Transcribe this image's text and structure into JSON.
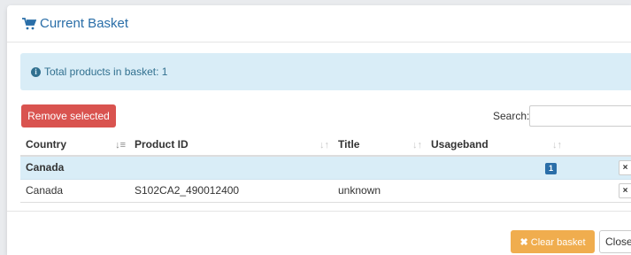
{
  "modal": {
    "title": "Current Basket"
  },
  "alert": {
    "text": "Total products in basket: 1"
  },
  "toolbar": {
    "remove_label": "Remove selected",
    "search_label": "Search:",
    "search_value": ""
  },
  "table": {
    "columns": [
      "Country",
      "Product ID",
      "Title",
      "Usageband",
      ""
    ],
    "group": {
      "name": "Canada",
      "count": "1",
      "action": "×"
    },
    "rows": [
      {
        "country": "Canada",
        "product_id": "S102CA2_490012400",
        "title": "unknown",
        "usageband": "",
        "action": "×"
      }
    ]
  },
  "footer": {
    "clear_label": "Clear basket",
    "close_label": "Close"
  },
  "colors": {
    "accent": "#2a6ea8",
    "danger": "#d9534f",
    "warning": "#f0ad4e",
    "info_bg": "#d9edf7"
  }
}
